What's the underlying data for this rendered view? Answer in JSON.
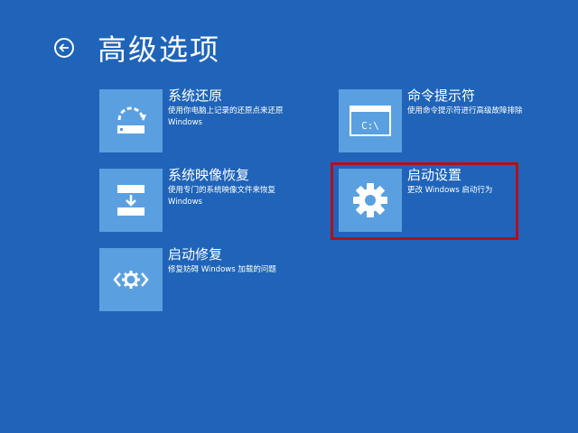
{
  "header": {
    "title": "高级选项"
  },
  "options": {
    "restore": {
      "title": "系统还原",
      "desc": "使用你电脑上记录的还原点来还原 Windows"
    },
    "image": {
      "title": "系统映像恢复",
      "desc": "使用专门的系统映像文件来恢复 Windows"
    },
    "repair": {
      "title": "启动修复",
      "desc": "修复妨碍 Windows 加载的问题"
    },
    "cmd": {
      "title": "命令提示符",
      "desc": "使用命令提示符进行高级故障排除",
      "icon_text": "C:\\"
    },
    "startup": {
      "title": "启动设置",
      "desc": "更改 Windows 启动行为"
    }
  },
  "colors": {
    "background": "#1f64b8",
    "tile": "#5aa0e0",
    "highlight": "#b0101a"
  },
  "icons": [
    "back-arrow-icon",
    "system-restore-icon",
    "system-image-icon",
    "startup-repair-icon",
    "command-prompt-icon",
    "gear-icon"
  ]
}
